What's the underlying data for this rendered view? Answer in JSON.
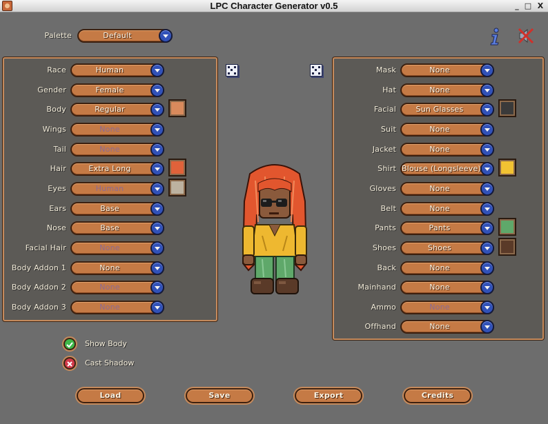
{
  "window": {
    "title": "LPC Character Generator v0.5",
    "minimize": "_",
    "maximize": "□",
    "close": "X"
  },
  "palette": {
    "label": "Palette",
    "value": "Default"
  },
  "icons": {
    "info": "info-icon",
    "no_sound": "speaker-muted-icon"
  },
  "left_rows": [
    {
      "label": "Race",
      "value": "Human",
      "disabled": false,
      "swatch": null
    },
    {
      "label": "Gender",
      "value": "Female",
      "disabled": false,
      "swatch": null
    },
    {
      "label": "Body",
      "value": "Regular",
      "disabled": false,
      "swatch": "#d98a5c"
    },
    {
      "label": "Wings",
      "value": "None",
      "disabled": true,
      "swatch": null
    },
    {
      "label": "Tail",
      "value": "None",
      "disabled": true,
      "swatch": null
    },
    {
      "label": "Hair",
      "value": "Extra Long",
      "disabled": false,
      "swatch": "#e0623a"
    },
    {
      "label": "Eyes",
      "value": "Human",
      "disabled": true,
      "swatch": "#bdb2a0"
    },
    {
      "label": "Ears",
      "value": "Base",
      "disabled": false,
      "swatch": null
    },
    {
      "label": "Nose",
      "value": "Base",
      "disabled": false,
      "swatch": null
    },
    {
      "label": "Facial Hair",
      "value": "None",
      "disabled": true,
      "swatch": null
    },
    {
      "label": "Body Addon 1",
      "value": "None",
      "disabled": false,
      "swatch": null
    },
    {
      "label": "Body Addon 2",
      "value": "None",
      "disabled": true,
      "swatch": null
    },
    {
      "label": "Body Addon 3",
      "value": "None",
      "disabled": true,
      "swatch": null
    }
  ],
  "right_rows": [
    {
      "label": "Mask",
      "value": "None",
      "disabled": false,
      "swatch": null
    },
    {
      "label": "Hat",
      "value": "None",
      "disabled": false,
      "swatch": null
    },
    {
      "label": "Facial",
      "value": "Sun Glasses",
      "disabled": false,
      "swatch": "#3a3a3a"
    },
    {
      "label": "Suit",
      "value": "None",
      "disabled": false,
      "swatch": null
    },
    {
      "label": "Jacket",
      "value": "None",
      "disabled": false,
      "swatch": null
    },
    {
      "label": "Shirt",
      "value": "Blouse (Longsleeve)",
      "disabled": false,
      "swatch": "#f2c232"
    },
    {
      "label": "Gloves",
      "value": "None",
      "disabled": false,
      "swatch": null
    },
    {
      "label": "Belt",
      "value": "None",
      "disabled": false,
      "swatch": null
    },
    {
      "label": "Pants",
      "value": "Pants",
      "disabled": false,
      "swatch": "#5fa86a"
    },
    {
      "label": "Shoes",
      "value": "Shoes",
      "disabled": false,
      "swatch": "#5a3a28"
    },
    {
      "label": "Back",
      "value": "None",
      "disabled": false,
      "swatch": null
    },
    {
      "label": "Mainhand",
      "value": "None",
      "disabled": false,
      "swatch": null
    },
    {
      "label": "Ammo",
      "value": "None",
      "disabled": true,
      "swatch": null
    },
    {
      "label": "Offhand",
      "value": "None",
      "disabled": false,
      "swatch": null
    }
  ],
  "options": {
    "show_body": {
      "label": "Show Body",
      "checked": true
    },
    "cast_shadow": {
      "label": "Cast Shadow",
      "checked": false
    }
  },
  "buttons": {
    "load": "Load",
    "save": "Save",
    "export": "Export",
    "credits": "Credits"
  },
  "colors": {
    "panel_bg": "#5c5a56",
    "panel_border": "#c58a5c",
    "dropdown": "#c57a45",
    "arrow_button": "#3151b8",
    "check_on": "#3fb84a",
    "check_off": "#d23a4a"
  }
}
